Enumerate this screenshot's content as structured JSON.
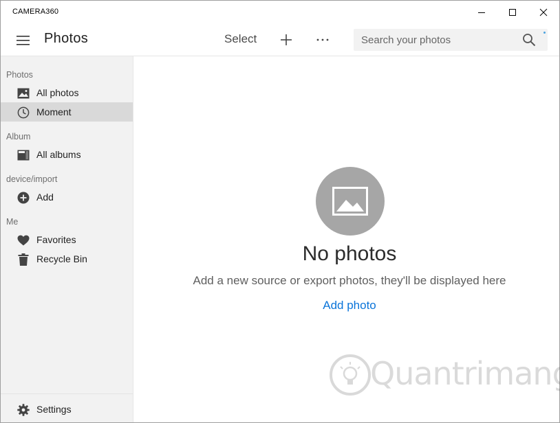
{
  "window": {
    "title": "CAMERA360",
    "controls": [
      "minimize-icon",
      "maximize-icon",
      "close-icon"
    ]
  },
  "header": {
    "title": "Photos",
    "select_label": "Select",
    "add_icon": "plus-icon",
    "more_icon": "more-icon",
    "search": {
      "placeholder": "Search your photos",
      "value": ""
    }
  },
  "sidebar": {
    "sections": [
      {
        "label": "Photos",
        "items": [
          {
            "label": "All photos",
            "icon": "image-icon"
          },
          {
            "label": "Moment",
            "icon": "clock-icon",
            "selected": true
          }
        ]
      },
      {
        "label": "Album",
        "items": [
          {
            "label": "All albums",
            "icon": "album-icon"
          }
        ]
      },
      {
        "label": "device/import",
        "items": [
          {
            "label": "Add",
            "icon": "add-circle-icon"
          }
        ]
      },
      {
        "label": "Me",
        "items": [
          {
            "label": "Favorites",
            "icon": "heart-icon"
          },
          {
            "label": "Recycle Bin",
            "icon": "trash-icon"
          }
        ]
      }
    ],
    "settings_label": "Settings"
  },
  "empty_state": {
    "title": "No photos",
    "subtitle": "Add a new source or export photos, they'll be displayed here",
    "action_label": "Add photo"
  },
  "watermark": {
    "text": "Quantrimang"
  },
  "colors": {
    "accent_link": "#0a74d9",
    "sidebar_bg": "#f2f2f2",
    "selected_bg": "#d9d9d9",
    "empty_icon_bg": "#a6a6a6"
  }
}
